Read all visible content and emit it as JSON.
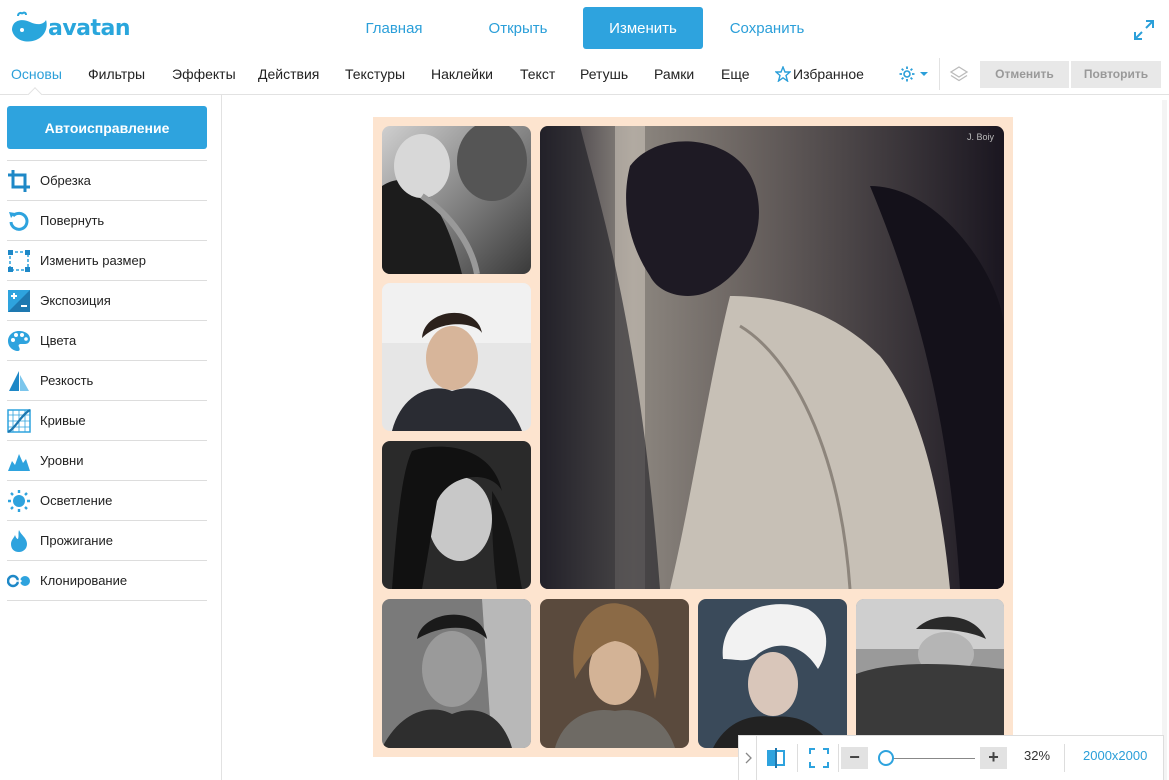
{
  "app": {
    "logo_text": "avatan",
    "accent": "#2ea3de"
  },
  "header": {
    "nav": [
      {
        "label": "Главная"
      },
      {
        "label": "Открыть"
      },
      {
        "label": "Изменить"
      },
      {
        "label": "Сохранить"
      }
    ],
    "active_nav": "Изменить"
  },
  "toolbar": {
    "tabs": [
      {
        "label": "Основы"
      },
      {
        "label": "Фильтры"
      },
      {
        "label": "Эффекты"
      },
      {
        "label": "Действия"
      },
      {
        "label": "Текстуры"
      },
      {
        "label": "Наклейки"
      },
      {
        "label": "Текст"
      },
      {
        "label": "Ретушь"
      },
      {
        "label": "Рамки"
      },
      {
        "label": "Еще"
      },
      {
        "label": "Избранное"
      }
    ],
    "active_tab": "Основы",
    "undo_label": "Отменить",
    "redo_label": "Повторить"
  },
  "sidebar": {
    "auto_fix_label": "Автоисправление",
    "tools": [
      {
        "label": "Обрезка",
        "icon": "crop-icon"
      },
      {
        "label": "Повернуть",
        "icon": "rotate-icon"
      },
      {
        "label": "Изменить размер",
        "icon": "resize-icon"
      },
      {
        "label": "Экспозиция",
        "icon": "exposure-icon"
      },
      {
        "label": "Цвета",
        "icon": "palette-icon"
      },
      {
        "label": "Резкость",
        "icon": "sharpness-icon"
      },
      {
        "label": "Кривые",
        "icon": "curves-icon"
      },
      {
        "label": "Уровни",
        "icon": "levels-icon"
      },
      {
        "label": "Осветление",
        "icon": "dodge-icon"
      },
      {
        "label": "Прожигание",
        "icon": "burn-icon"
      },
      {
        "label": "Клонирование",
        "icon": "clone-icon"
      }
    ]
  },
  "canvas": {
    "background_color": "#fde4cf",
    "watermark": "J. Boiy"
  },
  "zoom": {
    "percent_label": "32%",
    "value": 0.32,
    "image_size": "2000x2000"
  }
}
